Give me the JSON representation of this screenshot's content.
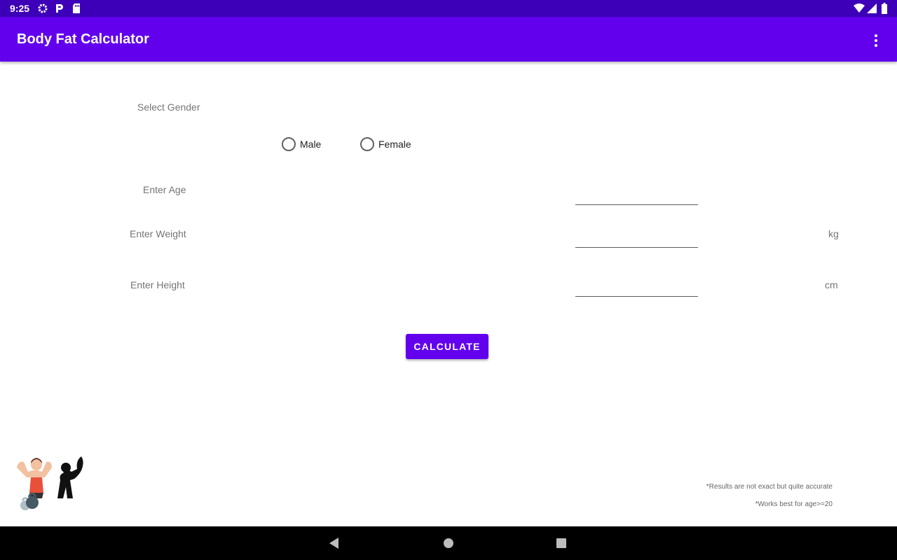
{
  "status_bar": {
    "time": "9:25"
  },
  "app_bar": {
    "title": "Body Fat Calculator"
  },
  "form": {
    "gender_label": "Select Gender",
    "gender_options": [
      "Male",
      "Female"
    ],
    "age_label": "Enter Age",
    "weight_label": "Enter Weight",
    "weight_unit": "kg",
    "height_label": "Enter Height",
    "height_unit": "cm",
    "age_value": "",
    "weight_value": "",
    "height_value": ""
  },
  "calculate_button": "CALCULATE",
  "notes": {
    "accuracy": "*Results are not exact but quite accurate",
    "age_hint": "*Works best for age>=20"
  },
  "colors": {
    "primary": "#6200ee",
    "status_bar": "#3d00b8",
    "nav_bar": "#000000"
  },
  "icons": [
    "settings-icon",
    "parking-icon",
    "sd-card-icon",
    "wifi-icon",
    "signal-icon",
    "battery-icon",
    "overflow-menu-icon",
    "back-icon",
    "home-icon",
    "recents-icon"
  ]
}
